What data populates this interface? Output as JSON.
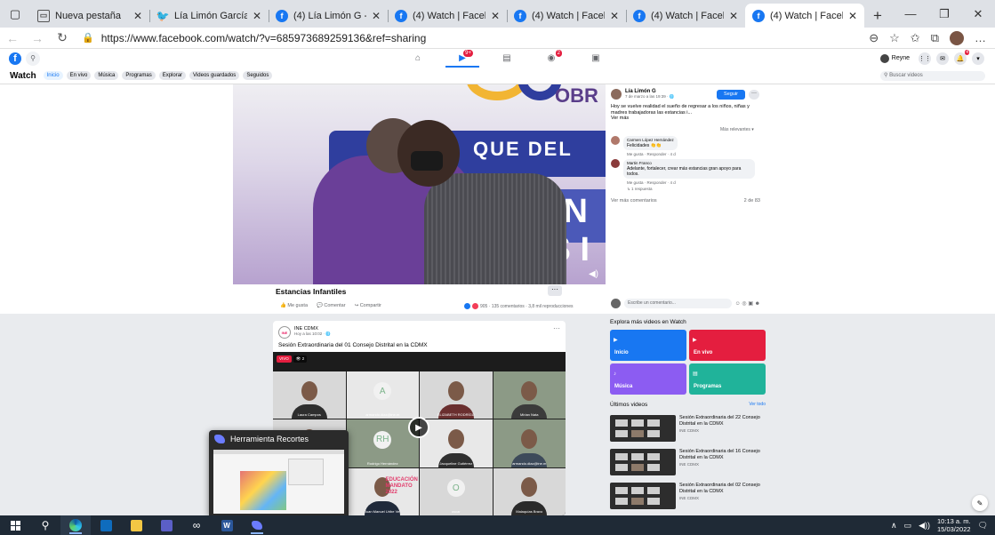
{
  "browser": {
    "tabs": [
      {
        "title": "Nueva pestaña",
        "icon": "page",
        "active": false
      },
      {
        "title": "Lía Limón García en Twitter",
        "icon": "twitter",
        "active": false
      },
      {
        "title": "(4) Lía Limón G - Publicaciones",
        "icon": "facebook",
        "active": false
      },
      {
        "title": "(4) Watch | Facebook",
        "icon": "facebook",
        "active": false
      },
      {
        "title": "(4) Watch | Facebook",
        "icon": "facebook",
        "active": false
      },
      {
        "title": "(4) Watch | Facebook",
        "icon": "facebook",
        "active": false
      },
      {
        "title": "(4) Watch | Facebook",
        "icon": "facebook",
        "active": true
      }
    ],
    "url": "https://www.facebook.com/watch/?v=685973689259136&ref=sharing"
  },
  "fb": {
    "nav_badge": "9+",
    "gaming_badge": "2",
    "user_name": "Reyne",
    "notif_badge": "4"
  },
  "watch": {
    "title": "Watch",
    "tabs": [
      "Inicio",
      "En vivo",
      "Música",
      "Programas",
      "Explorar",
      "Videos guardados",
      "Seguidos"
    ],
    "search_placeholder": "Buscar videos"
  },
  "post": {
    "video_texts": {
      "top_right": "OBR",
      "banner": "QUE DEL",
      "banner_big": "AN IS I"
    },
    "title": "Estancias Infantiles",
    "actions": [
      "Me gusta",
      "Comentar",
      "Compartir"
    ],
    "stats": "905 · 135 comentarios · 3,8 mil reproducciones",
    "author": "Lía Limón G",
    "date": "7 de marzo a las 19:39 · ",
    "follow_label": "Seguir",
    "text": "Hoy se vuelve realidad el sueño de regresar a los niños, niñas y madres trabajadoras las estancias i...",
    "see_more": "Ver más",
    "sort": "Más relevantes ▾",
    "comments": [
      {
        "author": "Carmen López Hernández",
        "text": "Felicidades 👏👏",
        "actions": "Me gusta · Responder · 4 d"
      },
      {
        "author": "Martin Franco",
        "text": "Adelante, fortalecer, crear más estancias gran apoyo para todos.",
        "actions": "Me gusta · Responder · 4 d",
        "replies": "1 respuesta"
      }
    ],
    "more_comments": "Ver más comentarios",
    "comment_count": "2 de 83",
    "compose_placeholder": "Escribe un comentario..."
  },
  "feed_post": {
    "page_name": "INE CDMX",
    "date": "Hoy a las 10:02 · ",
    "title": "Sesión Extraordinaria del 01 Consejo Distrital en la CDMX",
    "live": "VIVO",
    "viewers": "2",
    "participants": [
      {
        "name": "Laura Campos",
        "type": "person"
      },
      {
        "name": "armando.diaz@ine.m",
        "type": "initial",
        "initial": "A"
      },
      {
        "name": "ELIZABETH RODRÍGU",
        "type": "person"
      },
      {
        "name": "Mirian Nata",
        "type": "person"
      },
      {
        "name": "",
        "type": "person"
      },
      {
        "name": "Rodrigo Hernández",
        "type": "initial",
        "initial": "RH"
      },
      {
        "name": "Jacqueline Gutiérrez",
        "type": "person"
      },
      {
        "name": "armando.diaz@ine.m",
        "type": "person"
      },
      {
        "name": "",
        "type": "person"
      },
      {
        "name": "Juan Manuel Uribe Ver",
        "type": "person"
      },
      {
        "name": "oscar",
        "type": "initial",
        "initial": "O"
      },
      {
        "name": "Malaquías Bravo",
        "type": "person"
      }
    ],
    "overlay_text": "EDUCACIÓN MANDATO 2022"
  },
  "sidebar": {
    "explore_title": "Explora más videos en Watch",
    "tiles": [
      {
        "label": "Inicio",
        "color": "#1877f2"
      },
      {
        "label": "En vivo",
        "color": "#e41e3f"
      },
      {
        "label": "Música",
        "color": "#8c5cf2"
      },
      {
        "label": "Programas",
        "color": "#20b39a"
      }
    ],
    "latest_title": "Últimos videos",
    "see_all": "Ver todo",
    "videos": [
      {
        "title": "Sesión Extraordinaria del 22 Consejo Distrital en la CDMX",
        "channel": "INE CDMX"
      },
      {
        "title": "Sesión Extraordinaria del 16 Consejo Distrital en la CDMX",
        "channel": "INE CDMX"
      },
      {
        "title": "Sesión Extraordinaria del 02 Consejo Distrital en la CDMX",
        "channel": "INE CDMX"
      }
    ]
  },
  "snip": {
    "title": "Herramienta Recortes"
  },
  "taskbar": {
    "time": "10:13 a. m.",
    "date": "15/03/2022",
    "word_label": "W"
  }
}
